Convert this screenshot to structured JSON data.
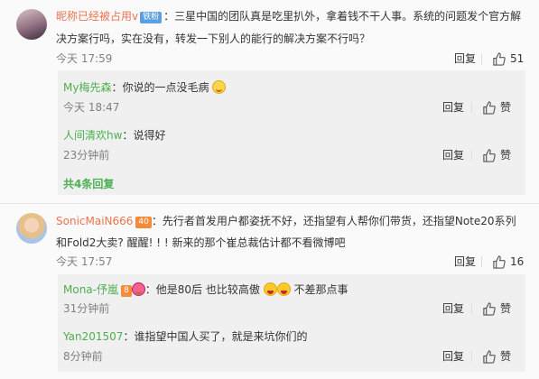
{
  "comments": [
    {
      "username": "昵称已经被占用v",
      "badge": "铁粉",
      "text_line1": "三星中国的团队真是吃里扒外，拿着钱不干人事。系统的问题发个官方解",
      "text_line2": "决方案行吗，实在没有，转发一下别人的能行的解决方案不行吗？",
      "time": "今天 17:59",
      "reply_label": "回复",
      "like_count": "51",
      "replies": [
        {
          "username": "My梅先森",
          "text": "你说的一点没毛病",
          "time": "今天 18:47",
          "reply_label": "回复",
          "like_label": "赞"
        },
        {
          "username": "人间清欢hw",
          "text": "说得好",
          "time": "23分钟前",
          "reply_label": "回复",
          "like_label": "赞"
        }
      ],
      "more_replies": "共4条回复"
    },
    {
      "username": "SonicMaiN666",
      "badge": "40",
      "text_line1": "先行者首发用户都姿抚不好，还指望有人帮你们带货，还指望Note20系列",
      "text_line2": "和Fold2大卖? 醒醒! ! ! 新来的那个崔总裁估计都不看微博吧",
      "time": "今天 17:57",
      "reply_label": "回复",
      "like_count": "16",
      "replies": [
        {
          "username": "Mona-伃嵐",
          "badge": "8",
          "text_a": "他是80后 也比较高傲",
          "text_b": "不差那点事",
          "time": "31分钟前",
          "reply_label": "回复",
          "like_label": "赞"
        },
        {
          "username": "Yan201507",
          "text": "谁指望中国人买了，就是来坑你们的",
          "time": "8分钟前",
          "reply_label": "回复",
          "like_label": "赞"
        }
      ]
    }
  ],
  "colors": {
    "name": "#eb7350",
    "subname": "#4caf50",
    "muted": "#808080"
  }
}
